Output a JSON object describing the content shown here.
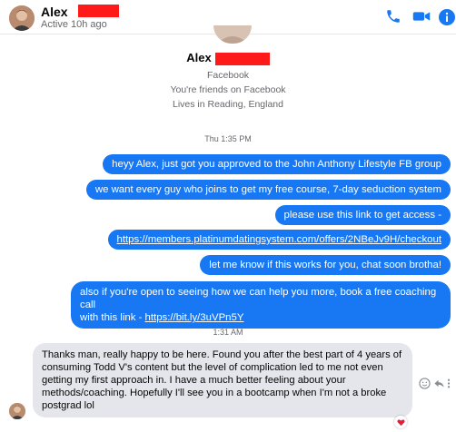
{
  "header": {
    "name": "Alex",
    "status": "Active 10h ago",
    "icons": [
      "phone-icon",
      "video-camera-icon",
      "info-icon"
    ],
    "accent": "#1877f2",
    "redaction_color": "#ff1a1a"
  },
  "profile": {
    "name": "Alex",
    "platform": "Facebook",
    "friends": "You're friends on Facebook",
    "location": "Lives in Reading, England"
  },
  "timestamps": [
    "Thu 1:35 PM",
    "1:31 AM"
  ],
  "outgoing": [
    {
      "text": "heyy Alex, just got you approved to the John Anthony Lifestyle FB group"
    },
    {
      "text": "we want every guy who joins to get my free course, 7-day seduction system"
    },
    {
      "text": "please use this link to get access -"
    },
    {
      "link": "https://members.platinumdatingsystem.com/offers/2NBeJv9H/checkout"
    },
    {
      "text": "let me know if this works for you, chat soon brotha!"
    },
    {
      "line1": "also if you're open to seeing how we can help you more, book a free coaching call",
      "line2_prefix": "with this link - ",
      "line2_link": "https://bit.ly/3uVPn5Y"
    }
  ],
  "incoming": {
    "text": "Thanks man, really happy to be here. Found you after the best part of 4 years of consuming Todd V's content but the level of complication led to me not even getting my first approach in. I have a much better feeling about your methods/coaching. Hopefully I'll see you in a bootcamp when I'm not a broke postgrad lol",
    "reaction": "heart",
    "actions": [
      "emoji-icon",
      "reply-icon",
      "more-icon"
    ]
  }
}
